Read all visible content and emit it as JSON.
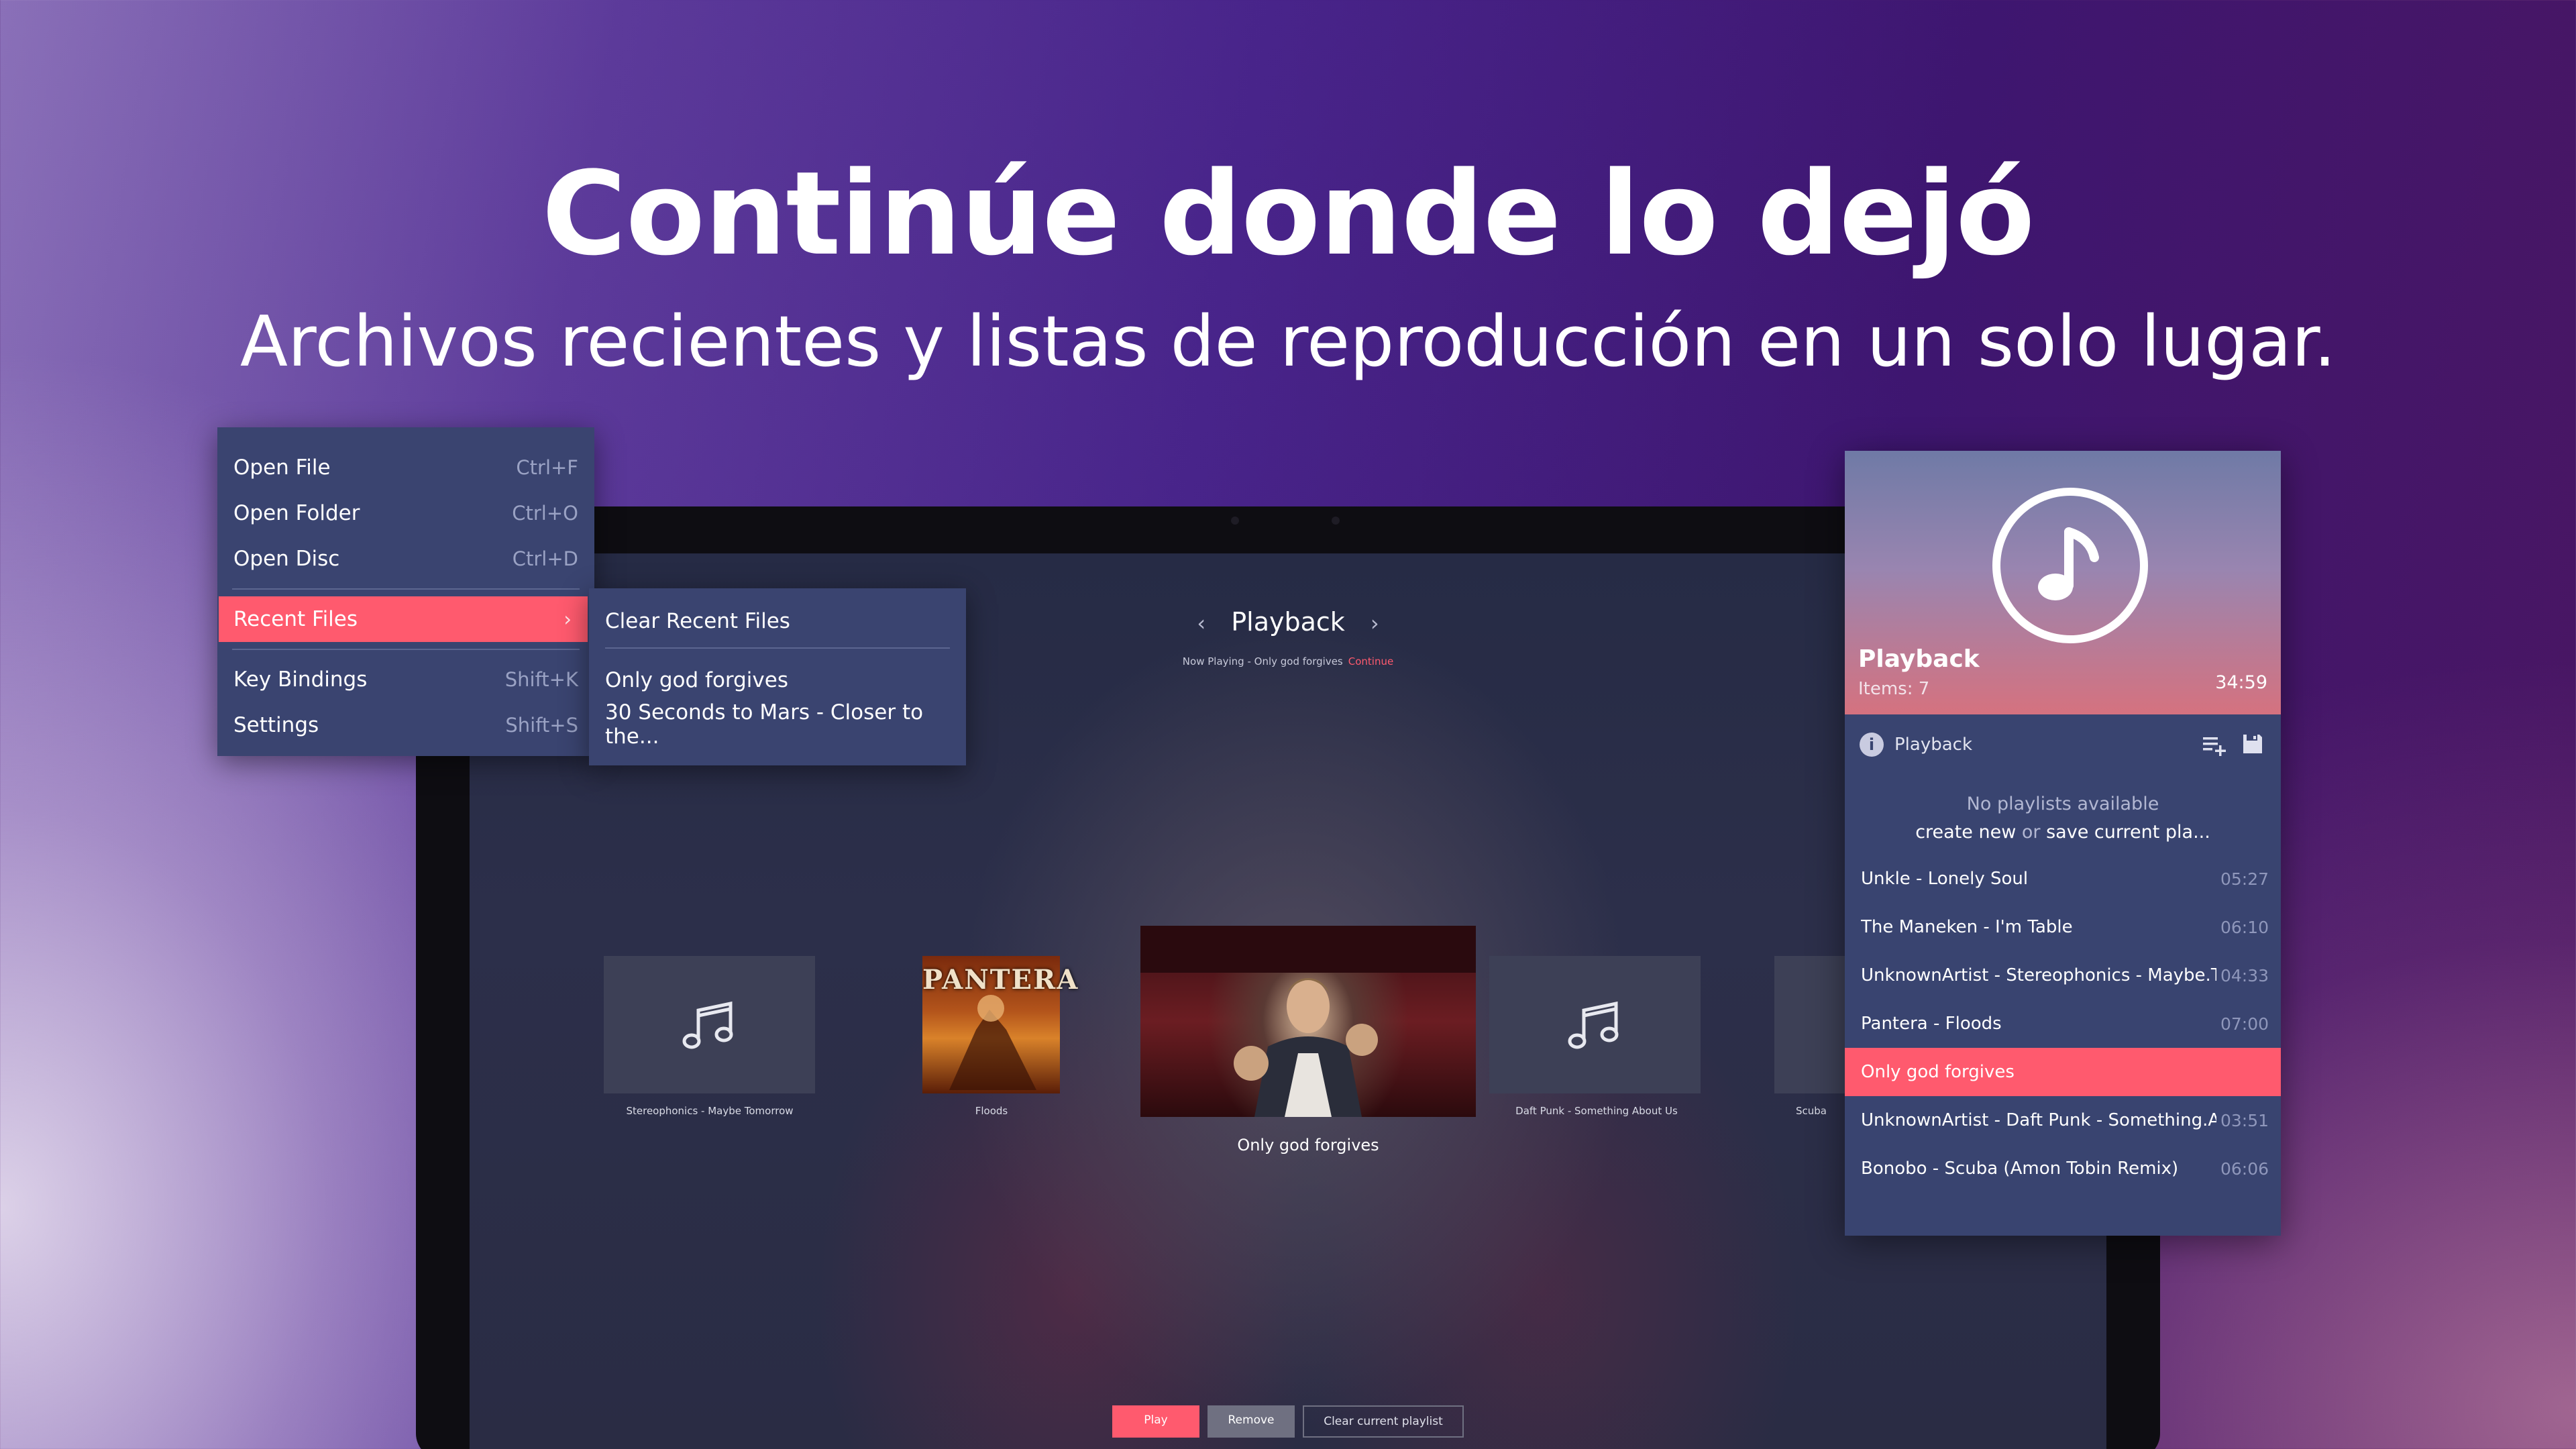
{
  "hero": {
    "title": "Continúe donde lo dejó",
    "subtitle": "Archivos recientes y listas de reproducción en un solo lugar."
  },
  "context_menu": {
    "items": [
      {
        "label": "Open File",
        "shortcut": "Ctrl+F"
      },
      {
        "label": "Open Folder",
        "shortcut": "Ctrl+O"
      },
      {
        "label": "Open Disc",
        "shortcut": "Ctrl+D"
      },
      {
        "label": "Recent Files",
        "shortcut": "›"
      },
      {
        "label": "Key Bindings",
        "shortcut": "Shift+K"
      },
      {
        "label": "Settings",
        "shortcut": "Shift+S"
      }
    ]
  },
  "recent_submenu": {
    "clear_label": "Clear Recent Files",
    "files": [
      "Only god forgives",
      "30 Seconds to Mars - Closer to the..."
    ]
  },
  "player": {
    "header": "Playback",
    "prev_icon": "‹",
    "next_icon": "›",
    "now_playing": "Now Playing - Only god forgives",
    "continue_label": "Continue",
    "covers": [
      {
        "caption": "Stereophonics - Maybe Tomorrow",
        "art": "music-note"
      },
      {
        "caption": "Floods",
        "art": "pantera-cover",
        "logo": "PANTERA"
      },
      {
        "caption": "Only god forgives",
        "art": "movie-still"
      },
      {
        "caption": "Daft Punk - Something About Us",
        "art": "music-note"
      },
      {
        "caption": "Scuba",
        "art": "music-note"
      }
    ],
    "buttons": {
      "play": "Play",
      "remove": "Remove",
      "clear": "Clear current playlist"
    }
  },
  "panel": {
    "title": "Playback",
    "items": "Items: 7",
    "duration": "34:59",
    "bar_label": "Playback",
    "no_playlists": "No playlists available",
    "create_new": "create new",
    "or": "or",
    "save_current": "save current pla...",
    "tracks": [
      {
        "name": "Unkle - Lonely Soul",
        "duration": "05:27"
      },
      {
        "name": "The Maneken - I'm Table",
        "duration": "06:10"
      },
      {
        "name": "UnknownArtist - Stereophonics - Maybe.T",
        "duration": "04:33"
      },
      {
        "name": "Pantera - Floods",
        "duration": "07:00"
      },
      {
        "name": "Only god forgives",
        "duration": ""
      },
      {
        "name": "UnknownArtist - Daft Punk - Something.A",
        "duration": "03:51"
      },
      {
        "name": "Bonobo - Scuba (Amon Tobin Remix)",
        "duration": "06:06"
      }
    ],
    "active_track_index": 4
  },
  "colors": {
    "accent": "#ff5a6e",
    "menu_bg": "#3a4470",
    "panel_bg": "#394470"
  }
}
